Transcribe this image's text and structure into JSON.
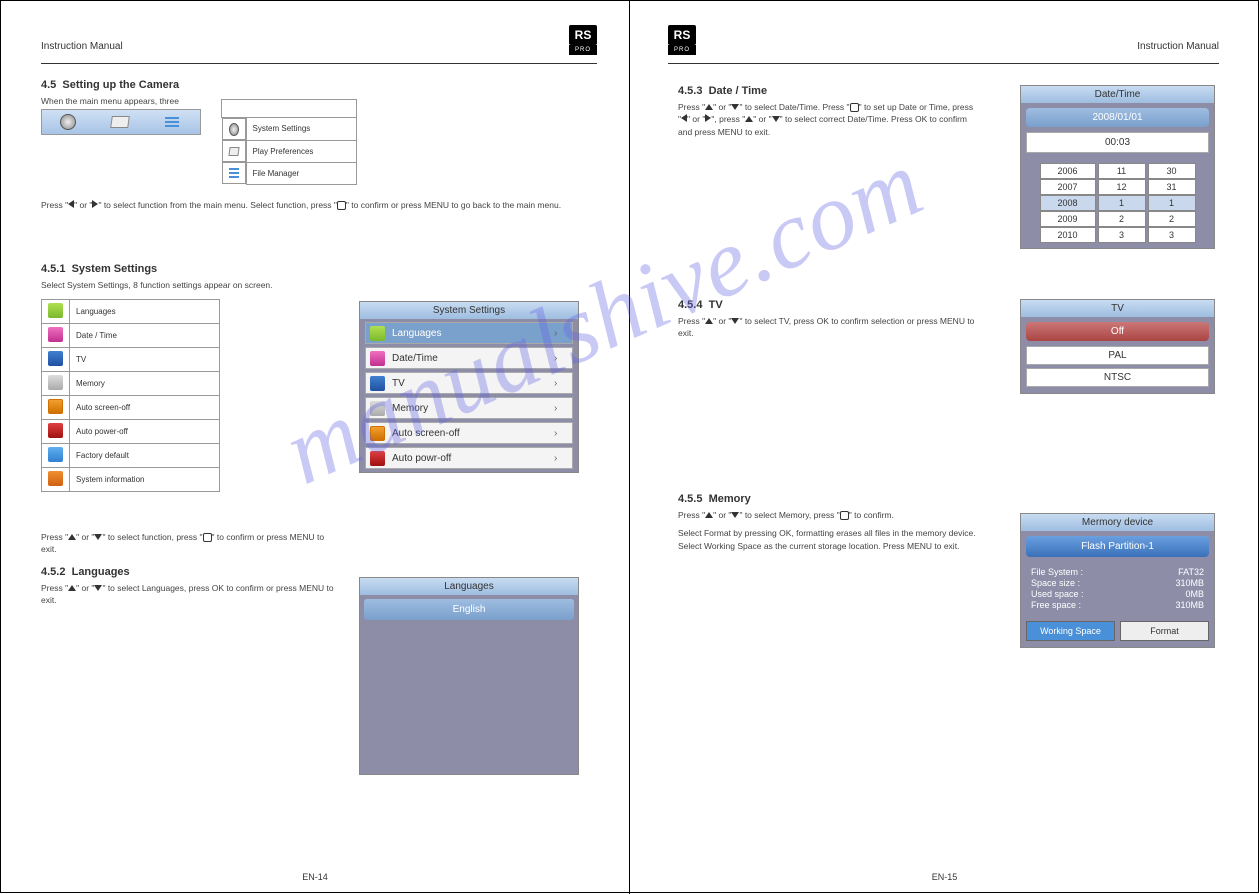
{
  "brand": {
    "rs": "RS",
    "pro": "PRO"
  },
  "doc": {
    "leftTitle": "Instruction Manual",
    "rightTitle": "Instruction Manual"
  },
  "watermark": "manualshive.com",
  "left": {
    "s45": {
      "num": "4.5",
      "title": "Setting up the Camera",
      "p1": "When the main menu appears, three function settings can be selected."
    },
    "mods": {
      "system": "System Settings",
      "play": "Play Preferences",
      "files": "File Manager",
      "instr": "Press \"  \" or \"  \" to select function from the main menu. Select function, press \"  \" to confirm or press MENU to go back to the main menu."
    },
    "s451": {
      "num": "4.5.1",
      "title": "System Settings",
      "p1": "Select System Settings, 8 function settings appear on screen.",
      "items": [
        "Languages",
        "Date / Time",
        "TV",
        "Memory",
        "Auto screen-off",
        "Auto power-off",
        "Factory default",
        "System information"
      ],
      "instr": "Press \"  \" or \"  \" to select function, press \"  \" to confirm or press MENU to exit."
    },
    "s452": {
      "num": "4.5.2",
      "title": "Languages",
      "instr": "Press \"  \" or \"  \" to select Languages, press OK to confirm or press MENU to exit."
    },
    "osdSys": {
      "title": "System Settings",
      "items": [
        "Languages",
        "Date/Time",
        "TV",
        "Memory",
        "Auto screen-off",
        "Auto powr-off"
      ]
    },
    "osdLang": {
      "title": "Languages",
      "item": "English"
    }
  },
  "right": {
    "s453": {
      "num": "4.5.3",
      "title": "Date / Time",
      "p": "Press \"  \" or \"  \" to select Date/Time. Press \"  \" to set up Date or Time, press \"  \" or \"  \" to select correct Date/Time. Press OK to confirm and press MENU to exit."
    },
    "s454": {
      "num": "4.5.4",
      "title": "TV",
      "p": "Press \"  \" or \"  \" to select TV, press OK to confirm selection or press MENU to exit."
    },
    "s455": {
      "num": "4.5.5",
      "title": "Memory",
      "p1": "Press \"  \" or \"  \" to select Memory, press \"  \" to confirm.",
      "p2": "Select Format by pressing OK, formatting erases all files in the memory device. Select Working Space as the current storage location. Press MENU to exit."
    },
    "osdDT": {
      "title": "Date/Time",
      "date": "2008/01/01",
      "time": "00:03",
      "years": [
        "2006",
        "2007",
        "2008",
        "2009",
        "2010"
      ],
      "months": [
        "11",
        "12",
        "1",
        "2",
        "3"
      ],
      "days": [
        "30",
        "31",
        "1",
        "2",
        "3"
      ]
    },
    "osdTV": {
      "title": "TV",
      "off": "Off",
      "opts": [
        "PAL",
        "NTSC"
      ]
    },
    "osdMem": {
      "title": "Mermory device",
      "dev": "Flash Partition-1",
      "fs_l": "File System :",
      "fs_v": "FAT32",
      "sz_l": "Space size  :",
      "sz_v": "310MB",
      "us_l": "Used space :",
      "us_v": "0MB",
      "fr_l": "Free space  :",
      "fr_v": "310MB",
      "b1": "Working Space",
      "b2": "Format"
    }
  },
  "pagenums": {
    "l": "EN-14",
    "r": "EN-15"
  }
}
